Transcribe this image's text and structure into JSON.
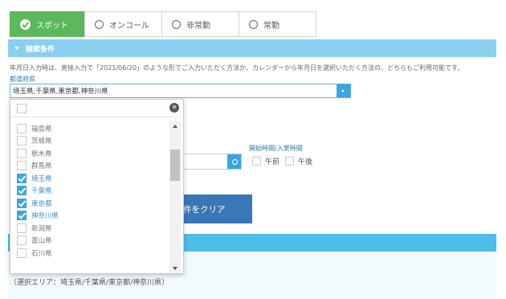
{
  "tabs": [
    {
      "label": "スポット",
      "active": true
    },
    {
      "label": "オンコール",
      "active": false
    },
    {
      "label": "非常勤",
      "active": false
    },
    {
      "label": "常勤",
      "active": false
    }
  ],
  "search": {
    "header": "検索条件",
    "note": "年月日入力時は、直接入力で「2021/06/20」のような形でご入力いただく方法か、カレンダーから年月日を選択いただく方法の、どちらもご利用可能です。",
    "prefecture_label": "都道府県",
    "prefecture_value": "埼玉県,千葉県,東京都,神奈川県",
    "time_label": "開始時間/入室時間",
    "am_label": "午前",
    "pm_label": "午後",
    "clear_label": "件をクリア"
  },
  "dropdown": {
    "items": [
      {
        "label": "福島県",
        "checked": false
      },
      {
        "label": "茨城県",
        "checked": false
      },
      {
        "label": "栃木県",
        "checked": false
      },
      {
        "label": "群馬県",
        "checked": false
      },
      {
        "label": "埼玉県",
        "checked": true
      },
      {
        "label": "千葉県",
        "checked": true
      },
      {
        "label": "東京都",
        "checked": true
      },
      {
        "label": "神奈川県",
        "checked": true
      },
      {
        "label": "新潟県",
        "checked": false
      },
      {
        "label": "富山県",
        "checked": false
      },
      {
        "label": "石川県",
        "checked": false
      }
    ]
  },
  "result": {
    "area_note": "（選択エリア：埼玉県/千葉県/東京都/神奈川県）"
  },
  "colors": {
    "active_tab": "#5cb85c",
    "section_header": "#8ad0ee",
    "accent_blue": "#3aa6e0",
    "clear_button": "#3a77b8"
  }
}
